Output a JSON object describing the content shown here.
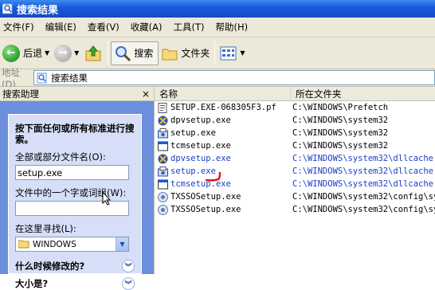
{
  "window": {
    "title": "搜索结果"
  },
  "menu": [
    "文件(F)",
    "编辑(E)",
    "查看(V)",
    "收藏(A)",
    "工具(T)",
    "帮助(H)"
  ],
  "toolbar": {
    "back_label": "后退",
    "search_label": "搜索",
    "folders_label": "文件夹"
  },
  "address": {
    "label": "地址(D)",
    "value": "搜索结果"
  },
  "search_pane": {
    "header": "搜索助理",
    "close_glyph": "×",
    "prompt": "按下面任何或所有标准进行搜索。",
    "name_label": "全部或部分文件名(O):",
    "name_value": "setup.exe",
    "phrase_label": "文件中的一个字或词组(W):",
    "phrase_value": "",
    "lookin_label": "在这里寻找(L):",
    "lookin_value": "WINDOWS",
    "modified_label": "什么时候修改的?",
    "size_label": "大小是?"
  },
  "results": {
    "columns": [
      "名称",
      "所在文件夹"
    ],
    "rows": [
      {
        "name": "SETUP.EXE-068305F3.pf",
        "folder": "C:\\WINDOWS\\Prefetch",
        "icon": "pf-file-icon",
        "compressed": false
      },
      {
        "name": "dpvsetup.exe",
        "folder": "C:\\WINDOWS\\system32",
        "icon": "dpv-app-icon",
        "compressed": false
      },
      {
        "name": "setup.exe",
        "folder": "C:\\WINDOWS\\system32",
        "icon": "setup-app-icon",
        "compressed": false
      },
      {
        "name": "tcmsetup.exe",
        "folder": "C:\\WINDOWS\\system32",
        "icon": "exe-window-icon",
        "compressed": false
      },
      {
        "name": "dpvsetup.exe",
        "folder": "C:\\WINDOWS\\system32\\dllcache",
        "icon": "dpv-app-icon",
        "compressed": true
      },
      {
        "name": "setup.exe",
        "folder": "C:\\WINDOWS\\system32\\dllcache",
        "icon": "setup-app-icon",
        "compressed": true
      },
      {
        "name": "tcmsetup.exe",
        "folder": "C:\\WINDOWS\\system32\\dllcache",
        "icon": "exe-window-icon",
        "compressed": true
      },
      {
        "name": "TXSSOSetup.exe",
        "folder": "C:\\WINDOWS\\system32\\config\\syst",
        "icon": "txsso-app-icon",
        "compressed": false
      },
      {
        "name": "TXSSOSetup.exe",
        "folder": "C:\\WINDOWS\\system32\\config\\syst",
        "icon": "txsso-app-icon",
        "compressed": false
      }
    ]
  },
  "colors": {
    "title_bar": "#1c5ad9",
    "compressed_text": "#1a3cc8",
    "pane_background": "#6b8fdc",
    "annotation": "#e0141e"
  }
}
